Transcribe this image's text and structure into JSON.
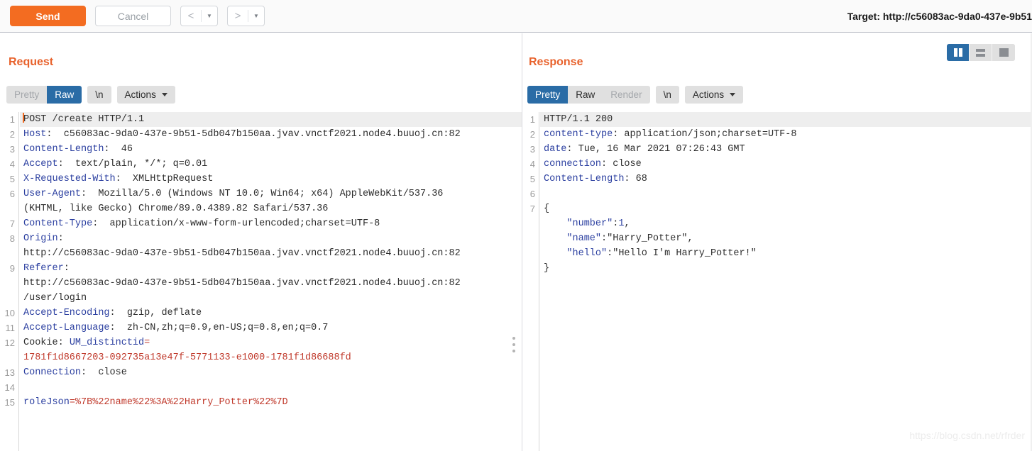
{
  "toolbar": {
    "send_label": "Send",
    "cancel_label": "Cancel",
    "prev_icon": "chevron-left-icon",
    "next_icon": "chevron-right-icon",
    "target_label": "Target: http://c56083ac-9da0-437e-9b51"
  },
  "layout_toggle": {
    "side_by_side": "split-vertical-icon",
    "stacked": "split-horizontal-icon",
    "single": "single-pane-icon",
    "active": "side_by_side"
  },
  "request": {
    "title": "Request",
    "tabs": [
      {
        "label": "Pretty",
        "active": false,
        "disabled": true
      },
      {
        "label": "Raw",
        "active": true,
        "disabled": false
      }
    ],
    "newline_label": "\\n",
    "actions_label": "Actions",
    "lines": [
      {
        "n": "1",
        "highlight": true,
        "caret": true,
        "spans": [
          {
            "t": "POST /create HTTP/1.1",
            "c": "val"
          }
        ]
      },
      {
        "n": "2",
        "spans": [
          {
            "t": "Host",
            "c": "hdr"
          },
          {
            "t": ":  c56083ac-9da0-437e-9b51-5db047b150aa.jvav.vnctf2021.node4.buuoj.cn:82",
            "c": "val"
          }
        ]
      },
      {
        "n": "3",
        "spans": [
          {
            "t": "Content-Length",
            "c": "hdr"
          },
          {
            "t": ":  46",
            "c": "val"
          }
        ]
      },
      {
        "n": "4",
        "spans": [
          {
            "t": "Accept",
            "c": "hdr"
          },
          {
            "t": ":  text/plain, */*; q=0.01",
            "c": "val"
          }
        ]
      },
      {
        "n": "5",
        "spans": [
          {
            "t": "X-Requested-With",
            "c": "hdr"
          },
          {
            "t": ":  XMLHttpRequest",
            "c": "val"
          }
        ]
      },
      {
        "n": "6",
        "spans": [
          {
            "t": "User-Agent",
            "c": "hdr"
          },
          {
            "t": ":  Mozilla/5.0 (Windows NT 10.0; Win64; x64) AppleWebKit/537.36",
            "c": "val"
          }
        ]
      },
      {
        "n": "",
        "spans": [
          {
            "t": "(KHTML, like Gecko) Chrome/89.0.4389.82 Safari/537.36",
            "c": "val"
          }
        ]
      },
      {
        "n": "7",
        "spans": [
          {
            "t": "Content-Type",
            "c": "hdr"
          },
          {
            "t": ":  application/x-www-form-urlencoded;charset=UTF-8",
            "c": "val"
          }
        ]
      },
      {
        "n": "8",
        "spans": [
          {
            "t": "Origin",
            "c": "hdr"
          },
          {
            "t": ":",
            "c": "val"
          }
        ]
      },
      {
        "n": "",
        "spans": [
          {
            "t": "http://c56083ac-9da0-437e-9b51-5db047b150aa.jvav.vnctf2021.node4.buuoj.cn:82",
            "c": "val"
          }
        ]
      },
      {
        "n": "9",
        "spans": [
          {
            "t": "Referer",
            "c": "hdr"
          },
          {
            "t": ":",
            "c": "val"
          }
        ]
      },
      {
        "n": "",
        "spans": [
          {
            "t": "http://c56083ac-9da0-437e-9b51-5db047b150aa.jvav.vnctf2021.node4.buuoj.cn:82",
            "c": "val"
          }
        ]
      },
      {
        "n": "",
        "spans": [
          {
            "t": "/user/login",
            "c": "val"
          }
        ]
      },
      {
        "n": "10",
        "spans": [
          {
            "t": "Accept-Encoding",
            "c": "hdr"
          },
          {
            "t": ":  gzip, deflate",
            "c": "val"
          }
        ]
      },
      {
        "n": "11",
        "spans": [
          {
            "t": "Accept-Language",
            "c": "hdr"
          },
          {
            "t": ":  zh-CN,zh;q=0.9,en-US;q=0.8,en;q=0.7",
            "c": "val"
          }
        ]
      },
      {
        "n": "12",
        "spans": [
          {
            "t": "Cookie: ",
            "c": "val"
          },
          {
            "t": "UM_distinctid",
            "c": "blue"
          },
          {
            "t": "=",
            "c": "red"
          }
        ]
      },
      {
        "n": "",
        "spans": [
          {
            "t": "1781f1d8667203-092735a13e47f-5771133-e1000-1781f1d86688fd",
            "c": "red"
          }
        ]
      },
      {
        "n": "13",
        "spans": [
          {
            "t": "Connection",
            "c": "hdr"
          },
          {
            "t": ":  close",
            "c": "val"
          }
        ]
      },
      {
        "n": "14",
        "spans": [
          {
            "t": "",
            "c": "val"
          }
        ]
      },
      {
        "n": "15",
        "spans": [
          {
            "t": "roleJson",
            "c": "blue"
          },
          {
            "t": "=%7B%22name%22%3A%22Harry_Potter%22%7D",
            "c": "red"
          }
        ]
      }
    ]
  },
  "response": {
    "title": "Response",
    "tabs": [
      {
        "label": "Pretty",
        "active": true,
        "disabled": false
      },
      {
        "label": "Raw",
        "active": false,
        "disabled": false
      },
      {
        "label": "Render",
        "active": false,
        "disabled": true
      }
    ],
    "newline_label": "\\n",
    "actions_label": "Actions",
    "lines": [
      {
        "n": "1",
        "highlight": true,
        "spans": [
          {
            "t": "HTTP/1.1 200",
            "c": "val"
          }
        ]
      },
      {
        "n": "2",
        "spans": [
          {
            "t": "content-type",
            "c": "hdr"
          },
          {
            "t": ": application/json;charset=UTF-8",
            "c": "val"
          }
        ]
      },
      {
        "n": "3",
        "spans": [
          {
            "t": "date",
            "c": "hdr"
          },
          {
            "t": ": Tue, 16 Mar 2021 07:26:43 GMT",
            "c": "val"
          }
        ]
      },
      {
        "n": "4",
        "spans": [
          {
            "t": "connection",
            "c": "hdr"
          },
          {
            "t": ": close",
            "c": "val"
          }
        ]
      },
      {
        "n": "5",
        "spans": [
          {
            "t": "Content-Length",
            "c": "hdr"
          },
          {
            "t": ": 68",
            "c": "val"
          }
        ]
      },
      {
        "n": "6",
        "spans": [
          {
            "t": "",
            "c": "val"
          }
        ]
      },
      {
        "n": "7",
        "spans": [
          {
            "t": "{",
            "c": "val"
          }
        ]
      },
      {
        "n": "",
        "spans": [
          {
            "t": "    ",
            "c": "val"
          },
          {
            "t": "\"number\"",
            "c": "blue"
          },
          {
            "t": ":",
            "c": "val"
          },
          {
            "t": "1",
            "c": "blue"
          },
          {
            "t": ",",
            "c": "val"
          }
        ]
      },
      {
        "n": "",
        "spans": [
          {
            "t": "    ",
            "c": "val"
          },
          {
            "t": "\"name\"",
            "c": "blue"
          },
          {
            "t": ":\"Harry_Potter\",",
            "c": "val"
          }
        ]
      },
      {
        "n": "",
        "spans": [
          {
            "t": "    ",
            "c": "val"
          },
          {
            "t": "\"hello\"",
            "c": "blue"
          },
          {
            "t": ":\"Hello I'm Harry_Potter!\"",
            "c": "val"
          }
        ]
      },
      {
        "n": "",
        "spans": [
          {
            "t": "}",
            "c": "val"
          }
        ]
      }
    ]
  },
  "watermark": "https://blog.csdn.net/rfrder"
}
